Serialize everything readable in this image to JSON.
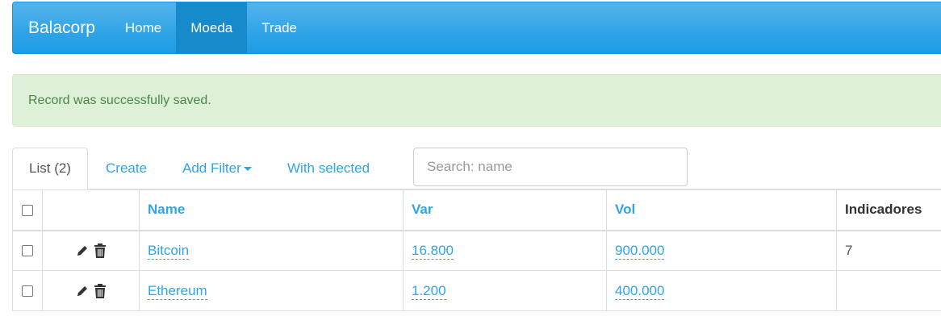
{
  "navbar": {
    "brand": "Balacorp",
    "items": [
      {
        "label": "Home",
        "active": false
      },
      {
        "label": "Moeda",
        "active": true
      },
      {
        "label": "Trade",
        "active": false
      }
    ]
  },
  "alert": {
    "message": "Record was successfully saved."
  },
  "tabs": {
    "list": "List (2)",
    "create": "Create",
    "add_filter": "Add Filter",
    "with_selected": "With selected"
  },
  "search": {
    "placeholder": "Search: name",
    "value": ""
  },
  "table": {
    "columns": [
      "Name",
      "Var",
      "Vol",
      "Indicadores"
    ],
    "rows": [
      {
        "name": "Bitcoin",
        "var": "16.800",
        "vol": "900.000",
        "indicadores": "7"
      },
      {
        "name": "Ethereum",
        "var": "1.200",
        "vol": "400.000",
        "indicadores": ""
      }
    ]
  },
  "icons": {
    "edit": "pencil-icon",
    "delete": "trash-icon"
  },
  "colors": {
    "primary": "#2fa4e7",
    "success_bg": "#dff0d8",
    "success_text": "#468847"
  }
}
